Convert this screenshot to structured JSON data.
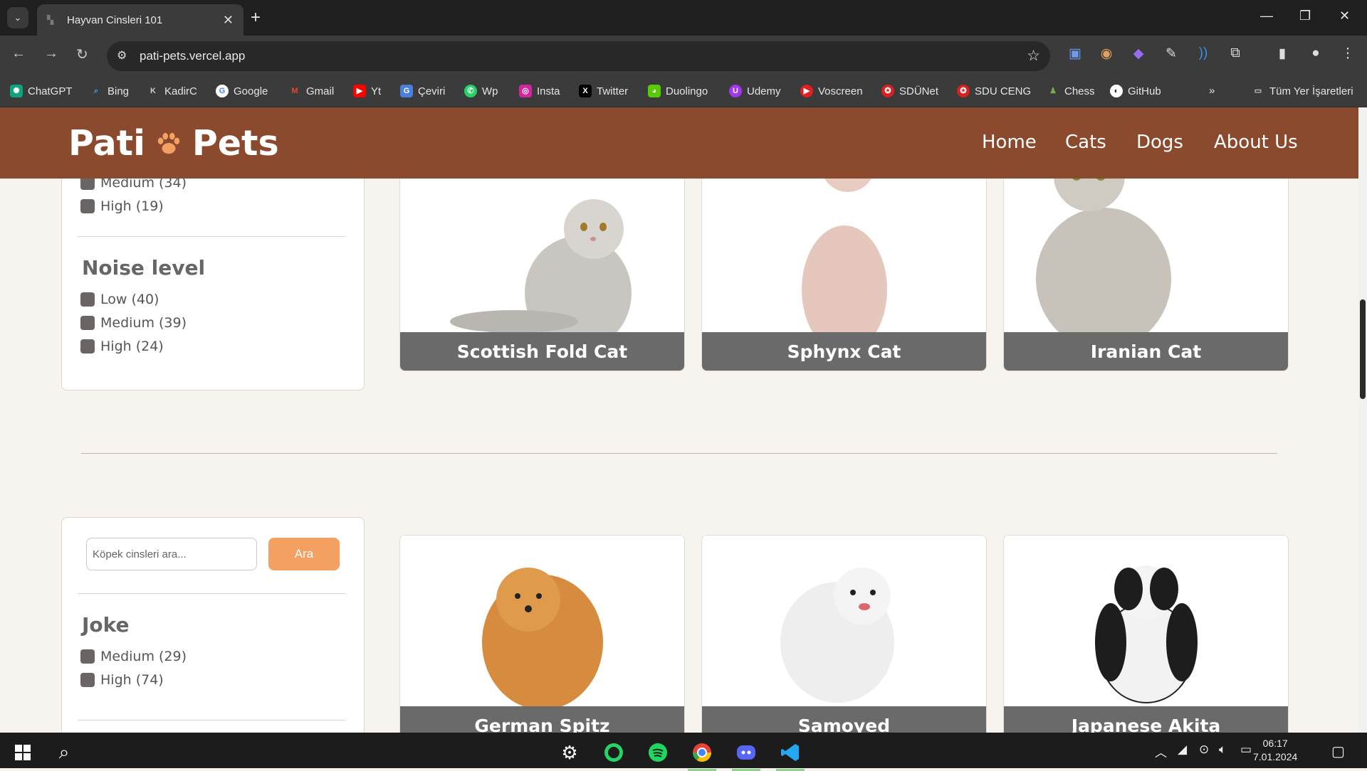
{
  "browser": {
    "tab_title": "Hayvan Cinsleri 101",
    "url": "pati-pets.vercel.app",
    "bookmarks": [
      {
        "label": "ChatGPT",
        "color": "#10a37f"
      },
      {
        "label": "Bing",
        "color": "#2b7fd6"
      },
      {
        "label": "KadirC",
        "color": "#9a9a9a"
      },
      {
        "label": "Google",
        "color": "#ffffff"
      },
      {
        "label": "Gmail",
        "color": "#ea4335"
      },
      {
        "label": "Yt",
        "color": "#ff0000"
      },
      {
        "label": "Çeviri",
        "color": "#4a7fe0"
      },
      {
        "label": "Wp",
        "color": "#25d366"
      },
      {
        "label": "Insta",
        "color": "#d6249f"
      },
      {
        "label": "Twitter",
        "color": "#000000"
      },
      {
        "label": "Duolingo",
        "color": "#58cc02"
      },
      {
        "label": "Udemy",
        "color": "#a435f0"
      },
      {
        "label": "Voscreen",
        "color": "#e02020"
      },
      {
        "label": "SDÜNet",
        "color": "#d82020"
      },
      {
        "label": "SDU CENG",
        "color": "#d82020"
      },
      {
        "label": "Chess",
        "color": "#7fa650"
      },
      {
        "label": "GitHub",
        "color": "#ffffff"
      }
    ],
    "all_bookmarks_label": "Tüm Yer İşaretleri"
  },
  "site": {
    "logo_left": "Pati",
    "logo_right": "Pets",
    "nav": [
      "Home",
      "Cats",
      "Dogs",
      "About Us"
    ]
  },
  "cat_filters": {
    "partial_items": [
      {
        "label": "Medium (34)"
      },
      {
        "label": "High (19)"
      }
    ],
    "noise_title": "Noise level",
    "noise_items": [
      {
        "label": "Low (40)"
      },
      {
        "label": "Medium (39)"
      },
      {
        "label": "High (24)"
      }
    ]
  },
  "cats": [
    {
      "name": "Scottish Fold Cat"
    },
    {
      "name": "Sphynx Cat"
    },
    {
      "name": "Iranian Cat"
    }
  ],
  "dog_filters": {
    "search_placeholder": "Köpek cinsleri ara...",
    "search_button": "Ara",
    "joke_title": "Joke",
    "joke_items": [
      {
        "label": "Medium (29)"
      },
      {
        "label": "High (74)"
      }
    ]
  },
  "dogs": [
    {
      "name": "German Spitz"
    },
    {
      "name": "Samoyed"
    },
    {
      "name": "Japanese Akita"
    }
  ],
  "taskbar": {
    "time": "06:17",
    "date": "7.01.2024"
  },
  "colors": {
    "header_brown": "#8b4a2e",
    "accent_orange": "#f3a062",
    "caption_gray": "#6a6a6a",
    "page_bg": "#f7f3ef"
  }
}
